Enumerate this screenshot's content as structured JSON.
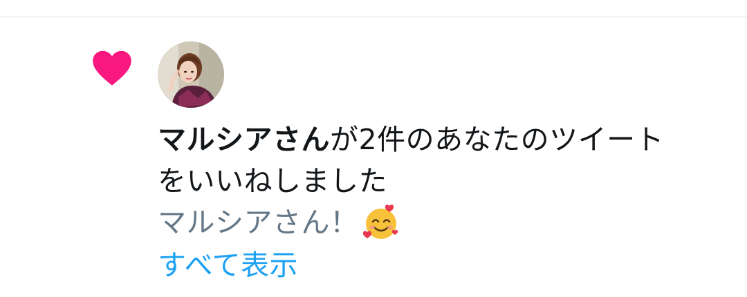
{
  "notification": {
    "icon": "heart-icon",
    "icon_color": "#f91880",
    "avatar": "user-avatar",
    "user_name": "マルシアさん",
    "action_text_line1": "が2件のあなたのツイート",
    "action_text_line2": "をいいねしました",
    "tweet_snippet": "マルシアさん！",
    "snippet_emoji": "smiling-face-with-hearts-icon",
    "show_all_label": "すべて表示",
    "link_color": "#1da1f2",
    "muted_text_color": "#657786"
  }
}
